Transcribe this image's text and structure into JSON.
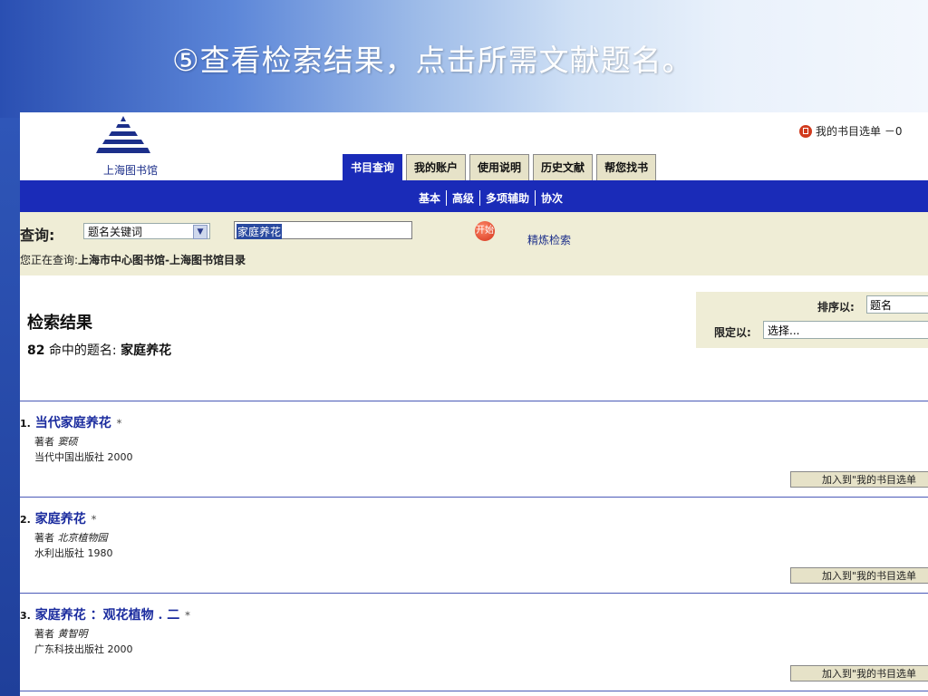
{
  "slide": {
    "title": "⑤查看检索结果，点击所需文献题名。"
  },
  "header": {
    "logo_text": "上海图书馆",
    "my_list": "我的书目选单 －0",
    "tabs": [
      "书目查询",
      "我的账户",
      "使用说明",
      "历史文献",
      "帮您找书"
    ]
  },
  "subnav": {
    "items": [
      "基本",
      "高级",
      "多项辅助",
      "协次"
    ]
  },
  "search": {
    "label": "查询:",
    "field_select": "题名关键词",
    "query": "家庭养花",
    "go": "开始",
    "refine": "精炼检索",
    "querying_prefix": "您正在查询:",
    "querying_target": "上海市中心图书馆-上海图书馆目录"
  },
  "results": {
    "title": "检索结果",
    "count": "82",
    "count_text": "命中的题名:",
    "count_query": "家庭养花",
    "sort_label": "排序以:",
    "sort_value": "题名",
    "limit_label": "限定以:",
    "limit_value": "选择...",
    "add_label": "加入到\"我的书目选单",
    "author_prefix": "著者",
    "records": [
      {
        "num": "1.",
        "title": "当代家庭养花",
        "author": "窦硕",
        "publisher": "当代中国出版社",
        "year": "2000"
      },
      {
        "num": "2.",
        "title": "家庭养花",
        "author": "北京植物园",
        "publisher": "水利出版社",
        "year": "1980"
      },
      {
        "num": "3.",
        "title": "家庭养花 ：观花植物 . 二",
        "author": "黄智明",
        "publisher": "广东科技出版社",
        "year": "2000"
      }
    ]
  }
}
